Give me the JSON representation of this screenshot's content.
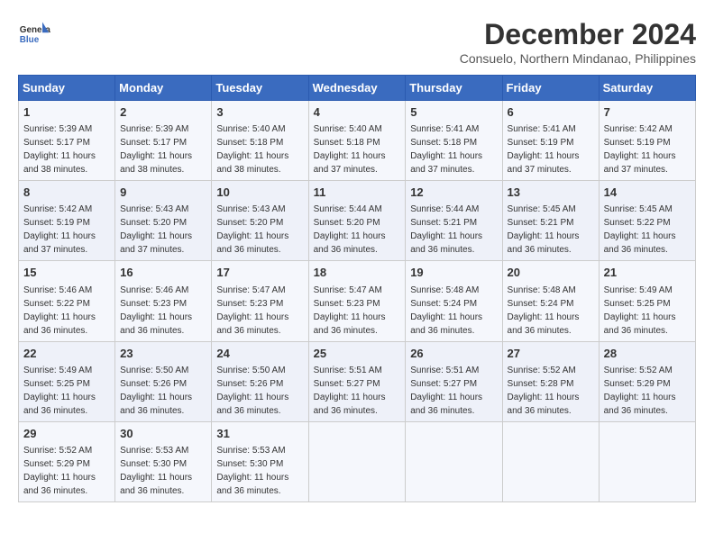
{
  "header": {
    "logo_line1": "General",
    "logo_line2": "Blue",
    "month": "December 2024",
    "location": "Consuelo, Northern Mindanao, Philippines"
  },
  "days_of_week": [
    "Sunday",
    "Monday",
    "Tuesday",
    "Wednesday",
    "Thursday",
    "Friday",
    "Saturday"
  ],
  "weeks": [
    [
      {
        "day": "1",
        "sunrise": "5:39 AM",
        "sunset": "5:17 PM",
        "daylight": "11 hours and 38 minutes."
      },
      {
        "day": "2",
        "sunrise": "5:39 AM",
        "sunset": "5:17 PM",
        "daylight": "11 hours and 38 minutes."
      },
      {
        "day": "3",
        "sunrise": "5:40 AM",
        "sunset": "5:18 PM",
        "daylight": "11 hours and 38 minutes."
      },
      {
        "day": "4",
        "sunrise": "5:40 AM",
        "sunset": "5:18 PM",
        "daylight": "11 hours and 37 minutes."
      },
      {
        "day": "5",
        "sunrise": "5:41 AM",
        "sunset": "5:18 PM",
        "daylight": "11 hours and 37 minutes."
      },
      {
        "day": "6",
        "sunrise": "5:41 AM",
        "sunset": "5:19 PM",
        "daylight": "11 hours and 37 minutes."
      },
      {
        "day": "7",
        "sunrise": "5:42 AM",
        "sunset": "5:19 PM",
        "daylight": "11 hours and 37 minutes."
      }
    ],
    [
      {
        "day": "8",
        "sunrise": "5:42 AM",
        "sunset": "5:19 PM",
        "daylight": "11 hours and 37 minutes."
      },
      {
        "day": "9",
        "sunrise": "5:43 AM",
        "sunset": "5:20 PM",
        "daylight": "11 hours and 37 minutes."
      },
      {
        "day": "10",
        "sunrise": "5:43 AM",
        "sunset": "5:20 PM",
        "daylight": "11 hours and 36 minutes."
      },
      {
        "day": "11",
        "sunrise": "5:44 AM",
        "sunset": "5:20 PM",
        "daylight": "11 hours and 36 minutes."
      },
      {
        "day": "12",
        "sunrise": "5:44 AM",
        "sunset": "5:21 PM",
        "daylight": "11 hours and 36 minutes."
      },
      {
        "day": "13",
        "sunrise": "5:45 AM",
        "sunset": "5:21 PM",
        "daylight": "11 hours and 36 minutes."
      },
      {
        "day": "14",
        "sunrise": "5:45 AM",
        "sunset": "5:22 PM",
        "daylight": "11 hours and 36 minutes."
      }
    ],
    [
      {
        "day": "15",
        "sunrise": "5:46 AM",
        "sunset": "5:22 PM",
        "daylight": "11 hours and 36 minutes."
      },
      {
        "day": "16",
        "sunrise": "5:46 AM",
        "sunset": "5:23 PM",
        "daylight": "11 hours and 36 minutes."
      },
      {
        "day": "17",
        "sunrise": "5:47 AM",
        "sunset": "5:23 PM",
        "daylight": "11 hours and 36 minutes."
      },
      {
        "day": "18",
        "sunrise": "5:47 AM",
        "sunset": "5:23 PM",
        "daylight": "11 hours and 36 minutes."
      },
      {
        "day": "19",
        "sunrise": "5:48 AM",
        "sunset": "5:24 PM",
        "daylight": "11 hours and 36 minutes."
      },
      {
        "day": "20",
        "sunrise": "5:48 AM",
        "sunset": "5:24 PM",
        "daylight": "11 hours and 36 minutes."
      },
      {
        "day": "21",
        "sunrise": "5:49 AM",
        "sunset": "5:25 PM",
        "daylight": "11 hours and 36 minutes."
      }
    ],
    [
      {
        "day": "22",
        "sunrise": "5:49 AM",
        "sunset": "5:25 PM",
        "daylight": "11 hours and 36 minutes."
      },
      {
        "day": "23",
        "sunrise": "5:50 AM",
        "sunset": "5:26 PM",
        "daylight": "11 hours and 36 minutes."
      },
      {
        "day": "24",
        "sunrise": "5:50 AM",
        "sunset": "5:26 PM",
        "daylight": "11 hours and 36 minutes."
      },
      {
        "day": "25",
        "sunrise": "5:51 AM",
        "sunset": "5:27 PM",
        "daylight": "11 hours and 36 minutes."
      },
      {
        "day": "26",
        "sunrise": "5:51 AM",
        "sunset": "5:27 PM",
        "daylight": "11 hours and 36 minutes."
      },
      {
        "day": "27",
        "sunrise": "5:52 AM",
        "sunset": "5:28 PM",
        "daylight": "11 hours and 36 minutes."
      },
      {
        "day": "28",
        "sunrise": "5:52 AM",
        "sunset": "5:29 PM",
        "daylight": "11 hours and 36 minutes."
      }
    ],
    [
      {
        "day": "29",
        "sunrise": "5:52 AM",
        "sunset": "5:29 PM",
        "daylight": "11 hours and 36 minutes."
      },
      {
        "day": "30",
        "sunrise": "5:53 AM",
        "sunset": "5:30 PM",
        "daylight": "11 hours and 36 minutes."
      },
      {
        "day": "31",
        "sunrise": "5:53 AM",
        "sunset": "5:30 PM",
        "daylight": "11 hours and 36 minutes."
      },
      null,
      null,
      null,
      null
    ]
  ]
}
